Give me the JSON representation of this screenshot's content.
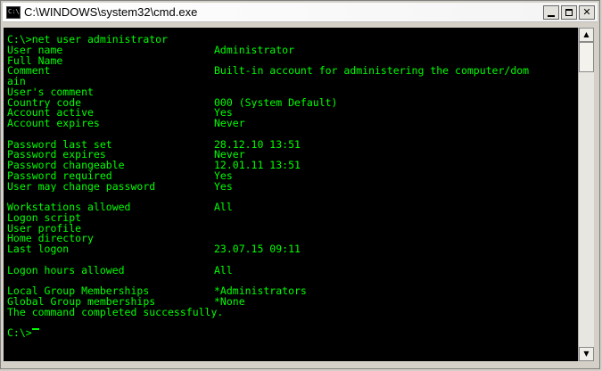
{
  "window": {
    "title": "C:\\WINDOWS\\system32\\cmd.exe",
    "icon_label": "C:\\",
    "icon": "console-icon",
    "buttons": {
      "minimize": "minimize-icon",
      "maximize": "maximize-icon",
      "close_glyph": "✕"
    }
  },
  "scrollbar": {
    "up_glyph": "▲",
    "down_glyph": "▼"
  },
  "colors": {
    "console_bg": "#000000",
    "console_text": "#00ff00"
  },
  "console": {
    "command_line": "C:\\>net user administrator",
    "rows": [
      {
        "label": "User name",
        "value": "Administrator"
      },
      {
        "label": "Full Name",
        "value": ""
      },
      {
        "label": "Comment",
        "value": "Built-in account for administering the computer/dom"
      },
      {
        "label": "ain",
        "value": ""
      },
      {
        "label": "User's comment",
        "value": ""
      },
      {
        "label": "Country code",
        "value": "000 (System Default)"
      },
      {
        "label": "Account active",
        "value": "Yes"
      },
      {
        "label": "Account expires",
        "value": "Never"
      },
      {
        "label": "",
        "value": ""
      },
      {
        "label": "Password last set",
        "value": "28.12.10 13:51"
      },
      {
        "label": "Password expires",
        "value": "Never"
      },
      {
        "label": "Password changeable",
        "value": "12.01.11 13:51"
      },
      {
        "label": "Password required",
        "value": "Yes"
      },
      {
        "label": "User may change password",
        "value": "Yes"
      },
      {
        "label": "",
        "value": ""
      },
      {
        "label": "Workstations allowed",
        "value": "All"
      },
      {
        "label": "Logon script",
        "value": ""
      },
      {
        "label": "User profile",
        "value": ""
      },
      {
        "label": "Home directory",
        "value": ""
      },
      {
        "label": "Last logon",
        "value": "23.07.15 09:11"
      },
      {
        "label": "",
        "value": ""
      },
      {
        "label": "Logon hours allowed",
        "value": "All"
      },
      {
        "label": "",
        "value": ""
      },
      {
        "label": "Local Group Memberships",
        "value": "*Administrators"
      },
      {
        "label": "Global Group memberships",
        "value": "*None"
      }
    ],
    "result": "The command completed successfully.",
    "prompt": "C:\\>"
  }
}
